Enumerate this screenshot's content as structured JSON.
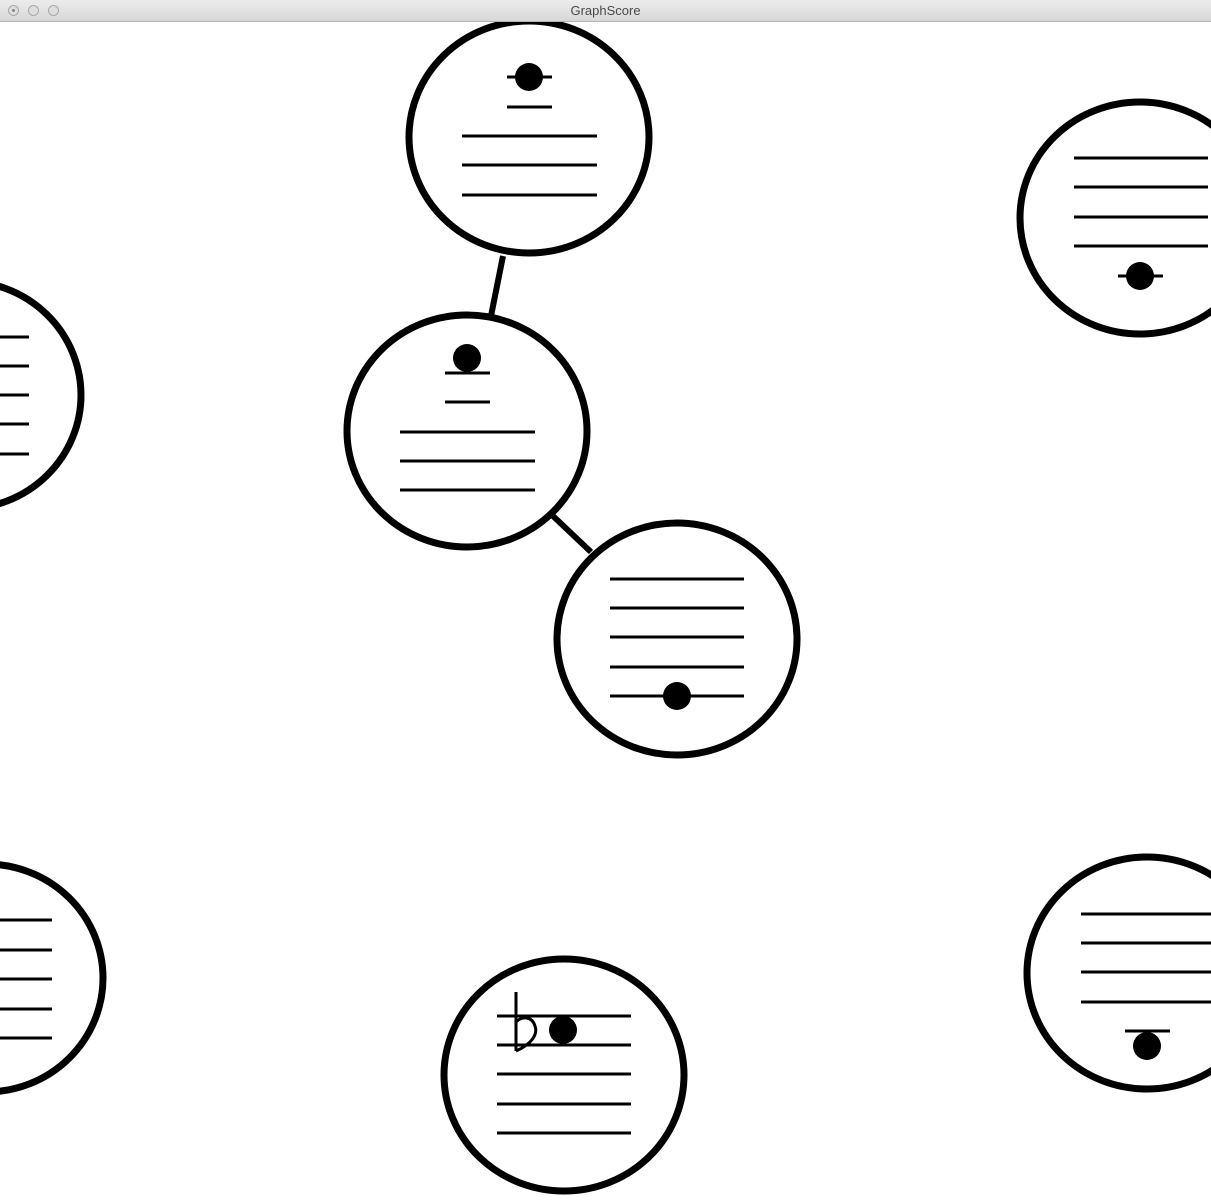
{
  "window": {
    "title": "GraphScore"
  },
  "graph": {
    "edges": [
      [
        "node-top",
        "node-center"
      ],
      [
        "node-center",
        "node-mid-right"
      ]
    ],
    "nodes": [
      {
        "id": "node-top",
        "note": "A6",
        "accidental": ""
      },
      {
        "id": "node-center",
        "note": "A6",
        "accidental": ""
      },
      {
        "id": "node-mid-right",
        "note": "E4",
        "accidental": ""
      },
      {
        "id": "node-right-upper",
        "note": "C4",
        "accidental": ""
      },
      {
        "id": "node-left-upper",
        "note": "",
        "accidental": ""
      },
      {
        "id": "node-left-lower",
        "note": "",
        "accidental": ""
      },
      {
        "id": "node-bottom",
        "note": "E5",
        "accidental": "flat"
      },
      {
        "id": "node-right-lower",
        "note": "B3",
        "accidental": ""
      }
    ]
  }
}
